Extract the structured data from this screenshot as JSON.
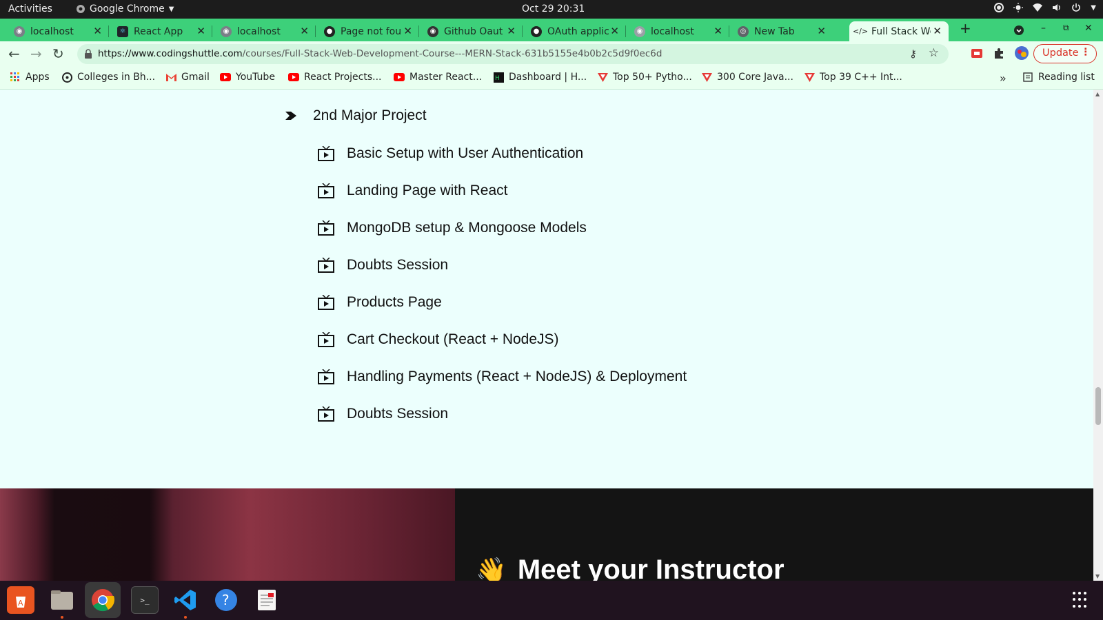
{
  "system_bar": {
    "activities": "Activities",
    "app_name": "Google Chrome",
    "datetime": "Oct 29  20:31"
  },
  "tabs": [
    {
      "title": "localhost",
      "icon": "globe-icon",
      "active": false
    },
    {
      "title": "React App",
      "icon": "react-icon",
      "active": false
    },
    {
      "title": "localhost",
      "icon": "globe-icon",
      "active": false
    },
    {
      "title": "Page not fou",
      "icon": "github-icon",
      "active": false
    },
    {
      "title": "Github Oaut",
      "icon": "globe-icon",
      "active": false
    },
    {
      "title": "OAuth applic",
      "icon": "github-icon",
      "active": false
    },
    {
      "title": "localhost",
      "icon": "globe-icon",
      "active": false
    },
    {
      "title": "New Tab",
      "icon": "chrome-icon",
      "active": false
    },
    {
      "title": "Full Stack We",
      "icon": "code-icon",
      "active": true
    }
  ],
  "toolbar": {
    "url_host": "https://www.codingshuttle.com",
    "url_path": "/courses/Full-Stack-Web-Development-Course---MERN-Stack-631b5155e4b0b2c5d9f0ec6d",
    "update_label": "Update"
  },
  "bookmarks": [
    {
      "label": "Apps",
      "icon": "apps-grid-icon"
    },
    {
      "label": "Colleges in Bh...",
      "icon": "globe-icon"
    },
    {
      "label": "Gmail",
      "icon": "gmail-icon"
    },
    {
      "label": "YouTube",
      "icon": "youtube-icon"
    },
    {
      "label": "React Projects...",
      "icon": "youtube-icon"
    },
    {
      "label": "Master React...",
      "icon": "youtube-icon"
    },
    {
      "label": "Dashboard | H...",
      "icon": "hackerrank-icon"
    },
    {
      "label": "Top 50+ Pytho...",
      "icon": "tpoint-icon"
    },
    {
      "label": "300 Core Java...",
      "icon": "tpoint-icon"
    },
    {
      "label": "Top 39 C++ Int...",
      "icon": "tpoint-icon"
    }
  ],
  "reading_list": "Reading list",
  "course": {
    "section_title": "2nd Major Project",
    "lectures": [
      "Basic Setup with User Authentication",
      "Landing Page with React",
      "MongoDB setup & Mongoose Models",
      "Doubts Session",
      "Products Page",
      "Cart Checkout (React + NodeJS)",
      "Handling Payments (React + NodeJS) & Deployment",
      "Doubts Session"
    ]
  },
  "instructor": {
    "emoji": "👋",
    "heading": "Meet your Instructor"
  },
  "dock": [
    {
      "name": "ubuntu-software-icon",
      "active": false,
      "running": false
    },
    {
      "name": "files-icon",
      "active": false,
      "running": true
    },
    {
      "name": "chrome-icon",
      "active": true,
      "running": true
    },
    {
      "name": "terminal-icon",
      "active": false,
      "running": false
    },
    {
      "name": "vscode-icon",
      "active": false,
      "running": true
    },
    {
      "name": "help-icon",
      "active": false,
      "running": false
    },
    {
      "name": "text-editor-icon",
      "active": false,
      "running": false
    }
  ],
  "colors": {
    "tab_strip": "#3dd07a",
    "toolbar": "#e9fff0",
    "page_bg": "#ecfffd",
    "update_red": "#d93025"
  }
}
